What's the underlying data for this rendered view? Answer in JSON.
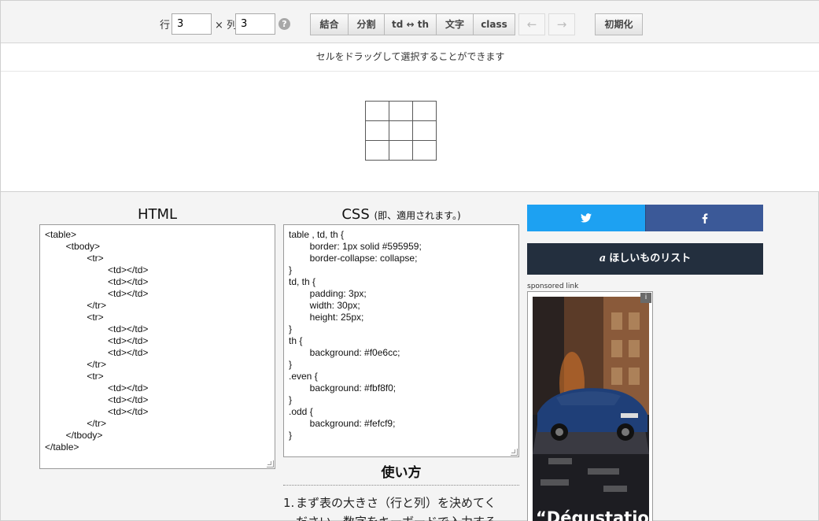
{
  "toolbar": {
    "rows_label": "行",
    "rows_value": "3",
    "times_label": "× 列",
    "cols_value": "3",
    "help": "?",
    "merge_label": "結合",
    "split_label": "分割",
    "td_th_label": "td ↔ th",
    "text_label": "文字",
    "class_label": "class",
    "undo_label": "←",
    "redo_label": "→",
    "reset_label": "初期化"
  },
  "instruction": "セルをドラッグして選択することができます",
  "preview": {
    "rows": 3,
    "cols": 3
  },
  "html_panel": {
    "title": "HTML",
    "lines": [
      "<table>",
      "        <tbody>",
      "                <tr>",
      "                        <td></td>",
      "                        <td></td>",
      "                        <td></td>",
      "                </tr>",
      "                <tr>",
      "                        <td></td>",
      "                        <td></td>",
      "                        <td></td>",
      "                </tr>",
      "                <tr>",
      "                        <td></td>",
      "                        <td></td>",
      "                        <td></td>",
      "                </tr>",
      "        </tbody>",
      "</table>"
    ]
  },
  "css_panel": {
    "title": "CSS",
    "note": "(即、適用されます。)",
    "lines": [
      "table , td, th {",
      "        border: 1px solid #595959;",
      "        border-collapse: collapse;",
      "}",
      "td, th {",
      "        padding: 3px;",
      "        width: 30px;",
      "        height: 25px;",
      "}",
      "th {",
      "        background: #f0e6cc;",
      "}",
      ".even {",
      "        background: #fbf8f0;",
      "}",
      ".odd {",
      "        background: #fefcf9;",
      "}"
    ]
  },
  "usage": {
    "title": "使い方",
    "item1_num": "1.",
    "item1_line1": "まず表の大きさ（行と列）を決めてく",
    "item1_line2": "ださい。数字をキーボードで入力する"
  },
  "share": {
    "twitter_icon": "twitter-icon",
    "facebook_icon": "facebook-icon"
  },
  "wishlist": {
    "label": "ほしいものリスト",
    "icon": "a"
  },
  "ad": {
    "sponsored": "sponsored link",
    "badge": "i",
    "caption": "“Dégustation"
  },
  "colors": {
    "twitter": "#1da1f2",
    "facebook": "#3b5998",
    "amazon": "#232f3e",
    "table_border": "#595959"
  }
}
